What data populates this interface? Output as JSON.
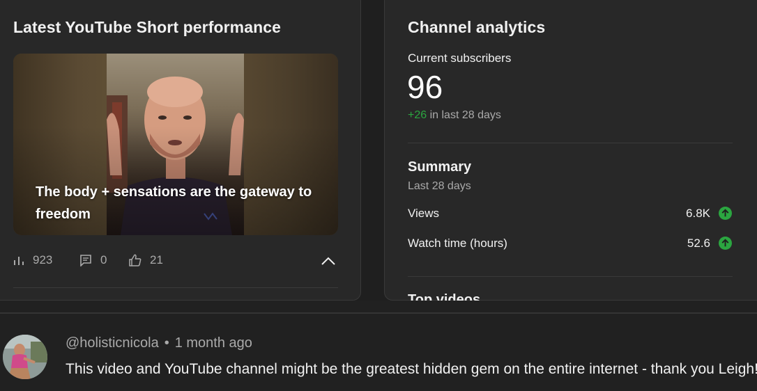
{
  "left_panel": {
    "title": "Latest YouTube Short performance",
    "short_caption": "The body + sensations are the gateway to freedom",
    "stats": {
      "views": "923",
      "comments": "0",
      "likes": "21"
    },
    "icons": [
      "bar-chart-icon",
      "comment-icon",
      "thumbs-up-icon",
      "chevron-up-icon"
    ]
  },
  "right_panel": {
    "title": "Channel analytics",
    "subscribers_label": "Current subscribers",
    "subscribers_count": "96",
    "subscribers_delta": "+26",
    "subscribers_delta_suffix": "in last 28 days",
    "summary_title": "Summary",
    "summary_period": "Last 28 days",
    "metrics": [
      {
        "label": "Views",
        "value": "6.8K",
        "trend": "up"
      },
      {
        "label": "Watch time (hours)",
        "value": "52.6",
        "trend": "up"
      }
    ],
    "top_videos_title": "Top videos"
  },
  "comment": {
    "handle": "@holisticnicola",
    "separator": "•",
    "time": "1 month ago",
    "text": "This video and YouTube channel might be the greatest hidden gem on the entire internet - thank you Leigh!"
  },
  "colors": {
    "background": "#1f1f1f",
    "card": "#282828",
    "positive": "#2ba640",
    "secondary_text": "#aaaaaa"
  }
}
